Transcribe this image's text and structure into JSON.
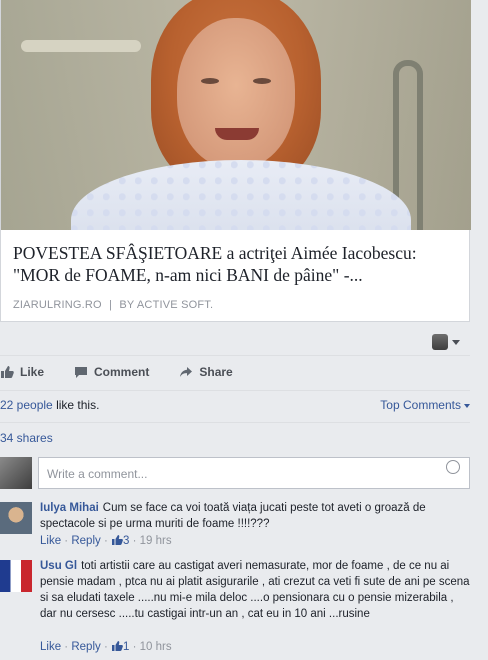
{
  "article": {
    "headline": "POVESTEA SFÂŞIETOARE a actriţei Aimée Iacobescu: \"MOR de FOAME, n-am nici BANI de pâine\" -...",
    "source": "ZIARULRING.RO",
    "separator": "|",
    "byline": "BY ACTIVE SOFT."
  },
  "actions": {
    "like": "Like",
    "comment": "Comment",
    "share": "Share"
  },
  "likes": {
    "count_text": "22 people",
    "suffix": "like this."
  },
  "top_comments_label": "Top Comments",
  "shares_text": "34 shares",
  "composer_placeholder": "Write a comment...",
  "comments": [
    {
      "author": "Iulya Mihai",
      "text": "Cum se face ca voi toată viața jucati peste tot aveti o groază de spectacole si pe urma muriti de foame !!!!???",
      "like_label": "Like",
      "reply_label": "Reply",
      "likes": "3",
      "time": "19 hrs"
    },
    {
      "author": "Usu Gl",
      "text": "toti artistii care au castigat averi nemasurate, mor de foame , de ce nu ai pensie madam , ptca nu ai platit asigurarile , ati crezut ca veti fi sute de ani pe scena si sa eludati taxele .....nu mi-e mila deloc ....o pensionara cu o pensie mizerabila , dar nu cersesc .....tu castigai intr-un an , cat eu in 10 ani ...rusine",
      "like_label": "Like",
      "reply_label": "Reply",
      "likes": "1",
      "time": "10 hrs"
    }
  ],
  "colors": {
    "link": "#365899",
    "meta": "#90949c",
    "text": "#1d2129"
  }
}
